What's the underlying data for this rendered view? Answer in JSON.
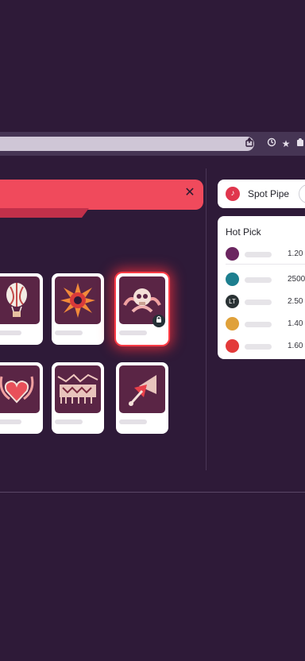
{
  "browser": {
    "icons": [
      "share-icon",
      "extension-icon",
      "bookmark-star-icon",
      "puzzle-icon"
    ]
  },
  "toolbar": {
    "close_symbol": "✕"
  },
  "grid": {
    "cards": [
      {
        "icon": "hot-air-balloon-icon"
      },
      {
        "icon": "starburst-icon"
      },
      {
        "icon": "skull-badge-icon",
        "selected": true,
        "badge": "lock-icon"
      },
      {
        "icon": "heart-emblem-icon"
      },
      {
        "icon": "wolves-pack-icon"
      },
      {
        "icon": "fan-pennant-icon"
      }
    ]
  },
  "brand": {
    "name": "Spot Pipe"
  },
  "hot_pick": {
    "title": "Hot Pick",
    "items": [
      {
        "icon_text": "",
        "color": "#6b2660",
        "value": "1.20"
      },
      {
        "icon_text": "",
        "color": "#1d7f8f",
        "value": "2500"
      },
      {
        "icon_text": "LT",
        "color": "#2a3234",
        "value": "2.50"
      },
      {
        "icon_text": "",
        "color": "#e0a13a",
        "value": "1.40"
      },
      {
        "icon_text": "",
        "color": "#e33a3a",
        "value": "1.60"
      }
    ]
  },
  "colors": {
    "background": "#2e1a38",
    "accent_red": "#f04a5c",
    "selection_glow": "#ff3c46",
    "card_art": "#5a2545"
  }
}
